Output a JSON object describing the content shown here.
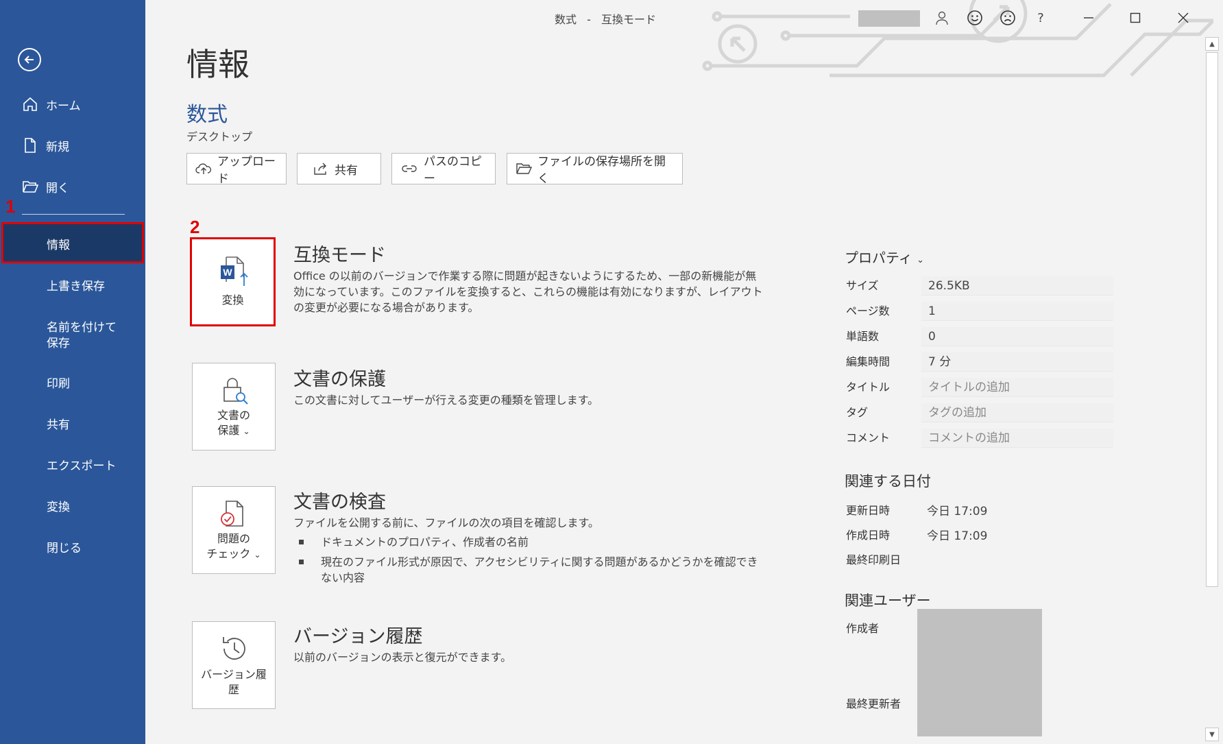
{
  "window": {
    "doc_title": "数式",
    "mode_sep": "-",
    "mode_title": "互換モード",
    "help": "?"
  },
  "sidebar": {
    "items": [
      {
        "label": "ホーム",
        "icon": "home-icon"
      },
      {
        "label": "新規",
        "icon": "new-document-icon"
      },
      {
        "label": "開く",
        "icon": "folder-open-icon"
      },
      {
        "label": "情報"
      },
      {
        "label": "上書き保存"
      },
      {
        "label": "名前を付けて保存"
      },
      {
        "label": "印刷"
      },
      {
        "label": "共有"
      },
      {
        "label": "エクスポート"
      },
      {
        "label": "変換"
      },
      {
        "label": "閉じる"
      }
    ],
    "marker1": "1"
  },
  "main": {
    "page_title": "情報",
    "doc_name": "数式",
    "doc_location": "デスクトップ",
    "actions": [
      {
        "label": "アップロード",
        "icon": "upload-cloud-icon"
      },
      {
        "label": "共有",
        "icon": "share-icon"
      },
      {
        "label": "パスのコピー",
        "icon": "link-icon"
      },
      {
        "label": "ファイルの保存場所を開く",
        "icon": "folder-open-icon"
      }
    ],
    "marker2": "2",
    "sections": [
      {
        "card_label": "変換",
        "title": "互換モード",
        "desc": "Office の以前のバージョンで作業する際に問題が起きないようにするため、一部の新機能が無効になっています。このファイルを変換すると、これらの機能は有効になりますが、レイアウトの変更が必要になる場合があります。"
      },
      {
        "card_label_1": "文書の",
        "card_label_2": "保護",
        "chevron": "⌄",
        "title": "文書の保護",
        "desc": "この文書に対してユーザーが行える変更の種類を管理します。"
      },
      {
        "card_label_1": "問題の",
        "card_label_2": "チェック",
        "chevron": "⌄",
        "title": "文書の検査",
        "desc": "ファイルを公開する前に、ファイルの次の項目を確認します。",
        "bullets": [
          "ドキュメントのプロパティ、作成者の名前",
          "現在のファイル形式が原因で、アクセシビリティに関する問題があるかどうかを確認できない内容"
        ]
      },
      {
        "card_label_1": "バージョン履",
        "card_label_2": "歴",
        "title": "バージョン履歴",
        "desc": "以前のバージョンの表示と復元ができます。"
      }
    ]
  },
  "properties": {
    "header": "プロパティ",
    "chevron": "⌄",
    "rows": [
      {
        "label": "サイズ",
        "value": "26.5KB"
      },
      {
        "label": "ページ数",
        "value": "1"
      },
      {
        "label": "単語数",
        "value": "0"
      },
      {
        "label": "編集時間",
        "value": "7 分"
      },
      {
        "label": "タイトル",
        "value": "タイトルの追加"
      },
      {
        "label": "タグ",
        "value": "タグの追加"
      },
      {
        "label": "コメント",
        "value": "コメントの追加"
      }
    ],
    "dates_header": "関連する日付",
    "dates": [
      {
        "label": "更新日時",
        "value": "今日 17:09"
      },
      {
        "label": "作成日時",
        "value": "今日 17:09"
      },
      {
        "label": "最終印刷日",
        "value": ""
      }
    ],
    "users_header": "関連ユーザー",
    "users": [
      {
        "label": "作成者"
      },
      {
        "label": "最終更新者"
      }
    ]
  },
  "colors": {
    "sidebar": "#2b579a",
    "sidebar_selected": "#1b3966",
    "highlight": "#e00000",
    "accent": "#2b579a"
  }
}
